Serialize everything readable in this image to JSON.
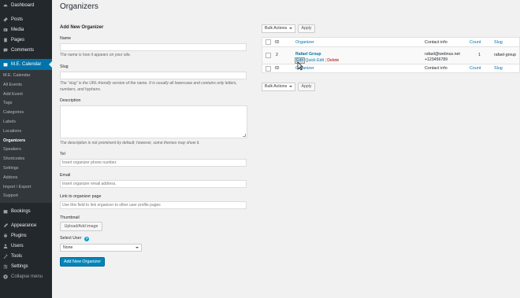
{
  "sidebar": {
    "top": [
      {
        "icon": "dashboard-icon",
        "label": "Dashboard"
      },
      {
        "icon": "pushpin-icon",
        "label": "Posts"
      },
      {
        "icon": "media-icon",
        "label": "Media"
      },
      {
        "icon": "pages-icon",
        "label": "Pages"
      },
      {
        "icon": "comments-icon",
        "label": "Comments"
      },
      {
        "icon": "calendar-icon",
        "label": "M.E. Calendar"
      }
    ],
    "sub": [
      "M.E. Calendar",
      "All Events",
      "Add Event",
      "Tags",
      "Categories",
      "Labels",
      "Locations",
      "Organizers",
      "Speakers",
      "Shortcodes",
      "Settings",
      "Addons",
      "Import / Export",
      "Support"
    ],
    "bottom": [
      {
        "icon": "bookings-icon",
        "label": "Bookings"
      },
      {
        "icon": "appearance-icon",
        "label": "Appearance"
      },
      {
        "icon": "plugins-icon",
        "label": "Plugins"
      },
      {
        "icon": "users-icon",
        "label": "Users"
      },
      {
        "icon": "tools-icon",
        "label": "Tools"
      },
      {
        "icon": "settings-icon",
        "label": "Settings"
      },
      {
        "icon": "collapse-icon",
        "label": "Collapse menu"
      }
    ]
  },
  "page": {
    "title": "Organizers"
  },
  "form": {
    "title": "Add New Organizer",
    "name_label": "Name",
    "name_desc": "The name is how it appears on your site.",
    "slug_label": "Slug",
    "slug_desc": "The “slug” is the URL-friendly version of the name. It is usually all lowercase and contains only letters, numbers, and hyphens.",
    "description_label": "Description",
    "description_desc": "The description is not prominent by default; however, some themes may show it.",
    "tel_label": "Tel",
    "tel_placeholder": "Insert organizer phone number.",
    "email_label": "Email",
    "email_placeholder": "Insert organizer email address.",
    "link_label": "Link to organizer page",
    "link_placeholder": "Use this field to link organizer to other user profile pages",
    "thumbnail_label": "Thumbnail",
    "upload_button": "Upload/Add image",
    "select_user_label": "Select User",
    "help_glyph": "?",
    "select_user_value": "None",
    "submit_button": "Add New Organizer"
  },
  "list": {
    "bulk_actions": "Bulk Actions",
    "apply": "Apply",
    "columns": {
      "id": "ID",
      "organizer": "Organizer",
      "contact": "Contact info",
      "count": "Count",
      "slug": "Slug"
    },
    "rows": [
      {
        "id": "2",
        "organizer": "Rafael Group",
        "email": "rafael@webnus.net",
        "phone": "+123456789",
        "count": "1",
        "slug": "rafael-group",
        "actions": {
          "edit": "Edit",
          "quick_edit": "Quick Edit",
          "delete": "Delete"
        }
      }
    ]
  },
  "colors": {
    "sidebar": "#23282d",
    "accent": "#0073aa",
    "primary_button": "#0085ba",
    "delete": "#a00"
  }
}
